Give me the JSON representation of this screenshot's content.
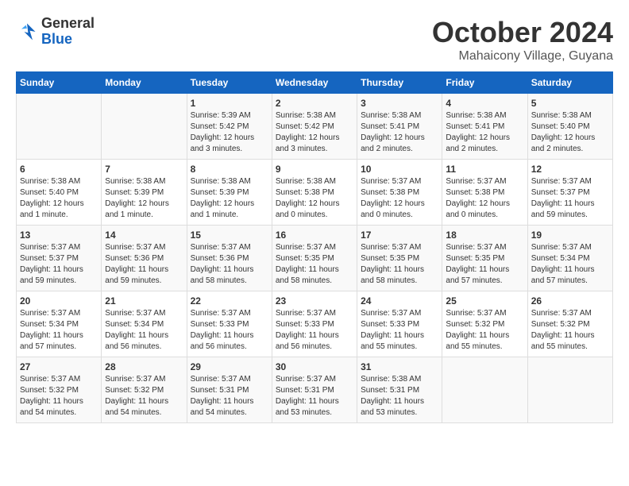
{
  "logo": {
    "general": "General",
    "blue": "Blue"
  },
  "title": "October 2024",
  "location": "Mahaicony Village, Guyana",
  "weekdays": [
    "Sunday",
    "Monday",
    "Tuesday",
    "Wednesday",
    "Thursday",
    "Friday",
    "Saturday"
  ],
  "weeks": [
    [
      {
        "day": "",
        "info": ""
      },
      {
        "day": "",
        "info": ""
      },
      {
        "day": "1",
        "info": "Sunrise: 5:39 AM\nSunset: 5:42 PM\nDaylight: 12 hours and 3 minutes."
      },
      {
        "day": "2",
        "info": "Sunrise: 5:38 AM\nSunset: 5:42 PM\nDaylight: 12 hours and 3 minutes."
      },
      {
        "day": "3",
        "info": "Sunrise: 5:38 AM\nSunset: 5:41 PM\nDaylight: 12 hours and 2 minutes."
      },
      {
        "day": "4",
        "info": "Sunrise: 5:38 AM\nSunset: 5:41 PM\nDaylight: 12 hours and 2 minutes."
      },
      {
        "day": "5",
        "info": "Sunrise: 5:38 AM\nSunset: 5:40 PM\nDaylight: 12 hours and 2 minutes."
      }
    ],
    [
      {
        "day": "6",
        "info": "Sunrise: 5:38 AM\nSunset: 5:40 PM\nDaylight: 12 hours and 1 minute."
      },
      {
        "day": "7",
        "info": "Sunrise: 5:38 AM\nSunset: 5:39 PM\nDaylight: 12 hours and 1 minute."
      },
      {
        "day": "8",
        "info": "Sunrise: 5:38 AM\nSunset: 5:39 PM\nDaylight: 12 hours and 1 minute."
      },
      {
        "day": "9",
        "info": "Sunrise: 5:38 AM\nSunset: 5:38 PM\nDaylight: 12 hours and 0 minutes."
      },
      {
        "day": "10",
        "info": "Sunrise: 5:37 AM\nSunset: 5:38 PM\nDaylight: 12 hours and 0 minutes."
      },
      {
        "day": "11",
        "info": "Sunrise: 5:37 AM\nSunset: 5:38 PM\nDaylight: 12 hours and 0 minutes."
      },
      {
        "day": "12",
        "info": "Sunrise: 5:37 AM\nSunset: 5:37 PM\nDaylight: 11 hours and 59 minutes."
      }
    ],
    [
      {
        "day": "13",
        "info": "Sunrise: 5:37 AM\nSunset: 5:37 PM\nDaylight: 11 hours and 59 minutes."
      },
      {
        "day": "14",
        "info": "Sunrise: 5:37 AM\nSunset: 5:36 PM\nDaylight: 11 hours and 59 minutes."
      },
      {
        "day": "15",
        "info": "Sunrise: 5:37 AM\nSunset: 5:36 PM\nDaylight: 11 hours and 58 minutes."
      },
      {
        "day": "16",
        "info": "Sunrise: 5:37 AM\nSunset: 5:35 PM\nDaylight: 11 hours and 58 minutes."
      },
      {
        "day": "17",
        "info": "Sunrise: 5:37 AM\nSunset: 5:35 PM\nDaylight: 11 hours and 58 minutes."
      },
      {
        "day": "18",
        "info": "Sunrise: 5:37 AM\nSunset: 5:35 PM\nDaylight: 11 hours and 57 minutes."
      },
      {
        "day": "19",
        "info": "Sunrise: 5:37 AM\nSunset: 5:34 PM\nDaylight: 11 hours and 57 minutes."
      }
    ],
    [
      {
        "day": "20",
        "info": "Sunrise: 5:37 AM\nSunset: 5:34 PM\nDaylight: 11 hours and 57 minutes."
      },
      {
        "day": "21",
        "info": "Sunrise: 5:37 AM\nSunset: 5:34 PM\nDaylight: 11 hours and 56 minutes."
      },
      {
        "day": "22",
        "info": "Sunrise: 5:37 AM\nSunset: 5:33 PM\nDaylight: 11 hours and 56 minutes."
      },
      {
        "day": "23",
        "info": "Sunrise: 5:37 AM\nSunset: 5:33 PM\nDaylight: 11 hours and 56 minutes."
      },
      {
        "day": "24",
        "info": "Sunrise: 5:37 AM\nSunset: 5:33 PM\nDaylight: 11 hours and 55 minutes."
      },
      {
        "day": "25",
        "info": "Sunrise: 5:37 AM\nSunset: 5:32 PM\nDaylight: 11 hours and 55 minutes."
      },
      {
        "day": "26",
        "info": "Sunrise: 5:37 AM\nSunset: 5:32 PM\nDaylight: 11 hours and 55 minutes."
      }
    ],
    [
      {
        "day": "27",
        "info": "Sunrise: 5:37 AM\nSunset: 5:32 PM\nDaylight: 11 hours and 54 minutes."
      },
      {
        "day": "28",
        "info": "Sunrise: 5:37 AM\nSunset: 5:32 PM\nDaylight: 11 hours and 54 minutes."
      },
      {
        "day": "29",
        "info": "Sunrise: 5:37 AM\nSunset: 5:31 PM\nDaylight: 11 hours and 54 minutes."
      },
      {
        "day": "30",
        "info": "Sunrise: 5:37 AM\nSunset: 5:31 PM\nDaylight: 11 hours and 53 minutes."
      },
      {
        "day": "31",
        "info": "Sunrise: 5:38 AM\nSunset: 5:31 PM\nDaylight: 11 hours and 53 minutes."
      },
      {
        "day": "",
        "info": ""
      },
      {
        "day": "",
        "info": ""
      }
    ]
  ]
}
